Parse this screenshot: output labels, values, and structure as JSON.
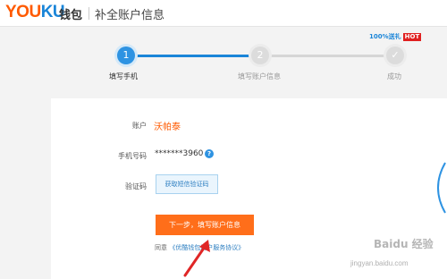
{
  "header": {
    "logo_you": "YOU",
    "logo_ku": "KU",
    "wallet": "钱包",
    "title": "补全账户信息"
  },
  "promo": {
    "text": "100%送礼",
    "hot": "HOT"
  },
  "steps": [
    {
      "number": "1",
      "label": "填写手机",
      "state": "active"
    },
    {
      "number": "2",
      "label": "填写账户信息",
      "state": "pending"
    },
    {
      "number": "✓",
      "label": "成功",
      "state": "pending"
    }
  ],
  "form": {
    "account_label": "账户",
    "account_value": "沃帕泰",
    "phone_label": "手机号码",
    "phone_value": "*******3960",
    "help": "?",
    "code_label": "验证码",
    "get_code_button": "获取短信验证码",
    "next_button": "下一步，填写账户信息",
    "agree_prefix": "同意",
    "agreement_link": "《优酷钱包用户服务协议》"
  },
  "watermark": {
    "text": "Baidu 经验",
    "sub": "jingyan.baidu.com"
  },
  "colors": {
    "accent_blue": "#1a85d8",
    "accent_orange": "#ff6e1a",
    "brand_orange": "#ff5a00"
  }
}
